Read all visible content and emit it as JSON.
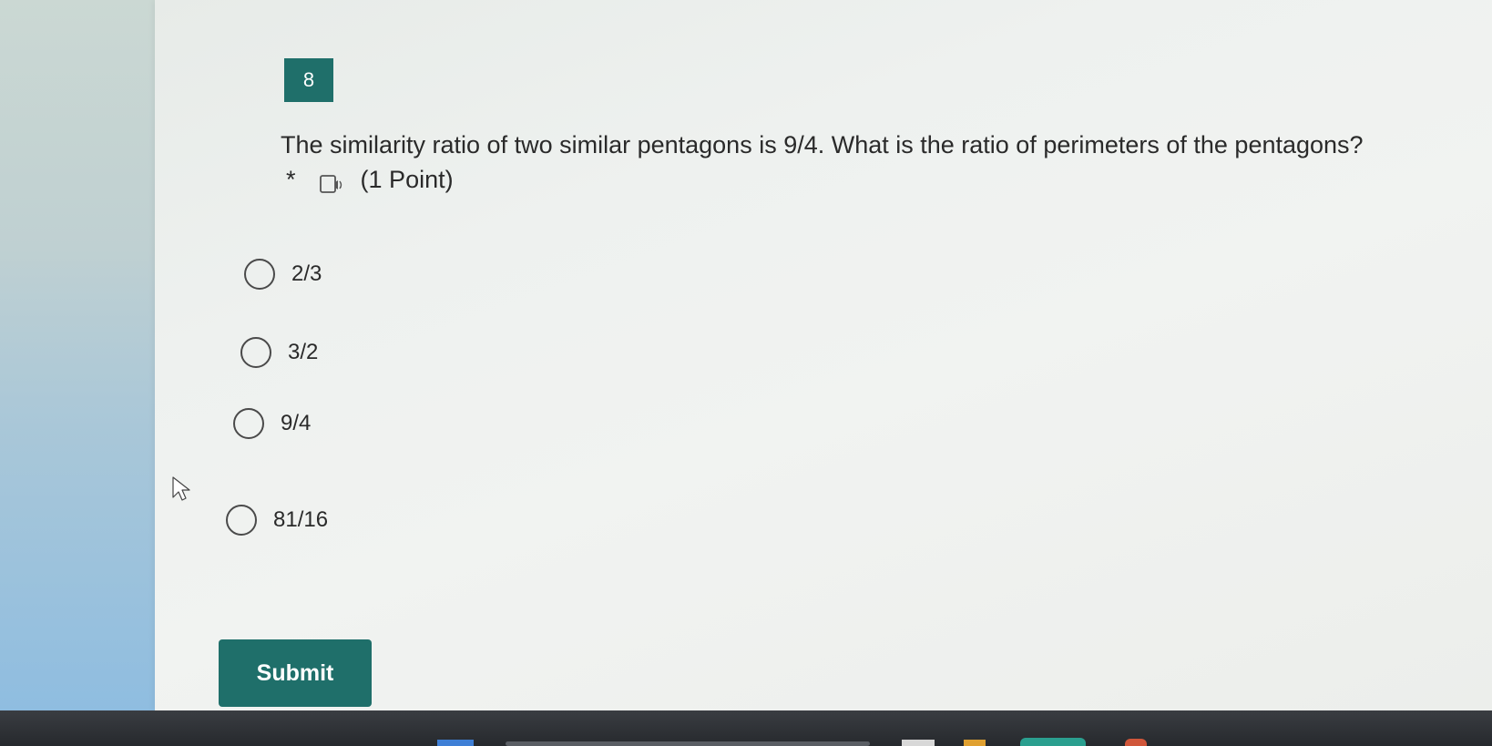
{
  "question": {
    "number": "8",
    "text": "The similarity ratio of two similar pentagons is 9/4. What is the ratio of perimeters of the pentagons?",
    "required_marker": "*",
    "points": "(1 Point)",
    "reader_icon": "immersive-reader-icon"
  },
  "options": [
    {
      "label": "2/3"
    },
    {
      "label": "3/2"
    },
    {
      "label": "9/4"
    },
    {
      "label": "81/16"
    }
  ],
  "submit": {
    "label": "Submit"
  },
  "colors": {
    "accent": "#1f6f6a",
    "text": "#2a2a2a"
  }
}
